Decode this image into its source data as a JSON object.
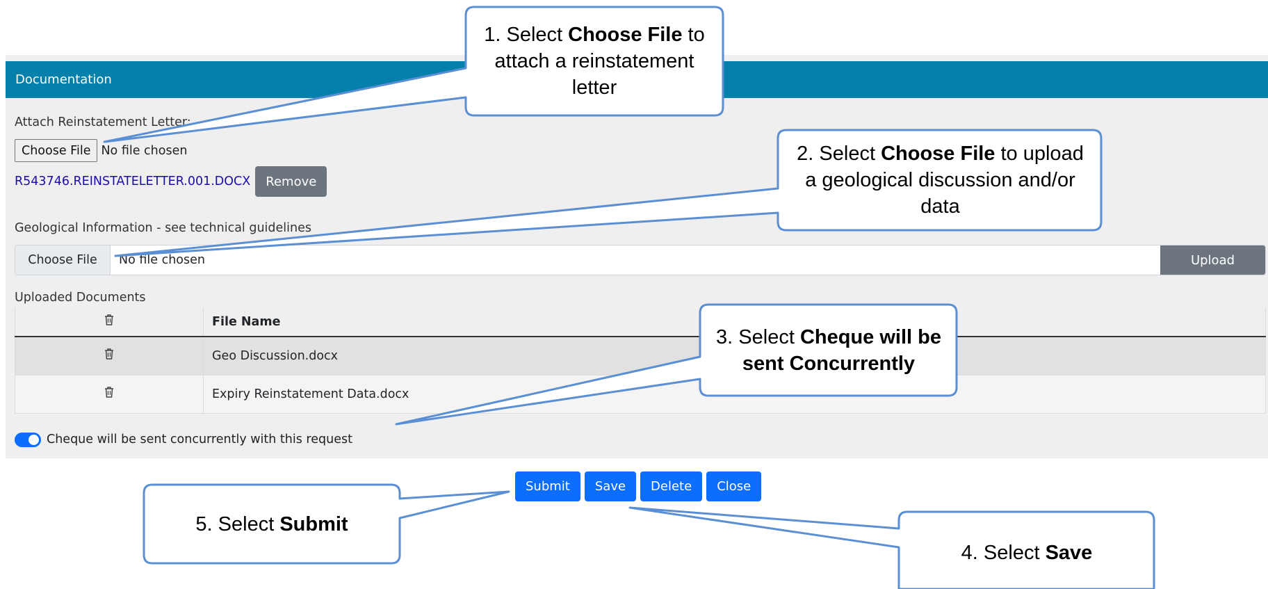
{
  "panel": {
    "header": "Documentation",
    "attach_label": "Attach Reinstatement Letter:",
    "choose_file": "Choose File",
    "no_file": "No file chosen",
    "attached_file": "R543746.REINSTATELETTER.001.DOCX",
    "remove_label": "Remove",
    "geo_label": "Geological Information - see technical guidelines",
    "upload_label": "Upload",
    "uploaded_label": "Uploaded Documents",
    "table": {
      "header": "File Name",
      "rows": [
        "Geo Discussion.docx",
        "Expiry Reinstatement Data.docx"
      ]
    },
    "toggle_label": "Cheque will be sent concurrently with this request"
  },
  "actions": {
    "submit": "Submit",
    "save": "Save",
    "delete": "Delete",
    "close": "Close"
  },
  "callouts": {
    "c1": {
      "a": "1. Select ",
      "b": "Choose File",
      "c": " to attach a reinstatement letter"
    },
    "c2": {
      "a": "2. Select ",
      "b": "Choose File",
      "c": " to upload a geological discussion and/or data"
    },
    "c3": {
      "a": "3. Select ",
      "b": "Cheque will be sent Concurrently",
      "c": ""
    },
    "c4": {
      "a": "4. Select ",
      "b": "Save",
      "c": ""
    },
    "c5": {
      "a": "5. Select ",
      "b": "Submit",
      "c": ""
    }
  },
  "colors": {
    "header": "#0480ab",
    "primary": "#0d6efd",
    "secondary": "#6c757d",
    "callout_border": "#5b8fd3"
  }
}
